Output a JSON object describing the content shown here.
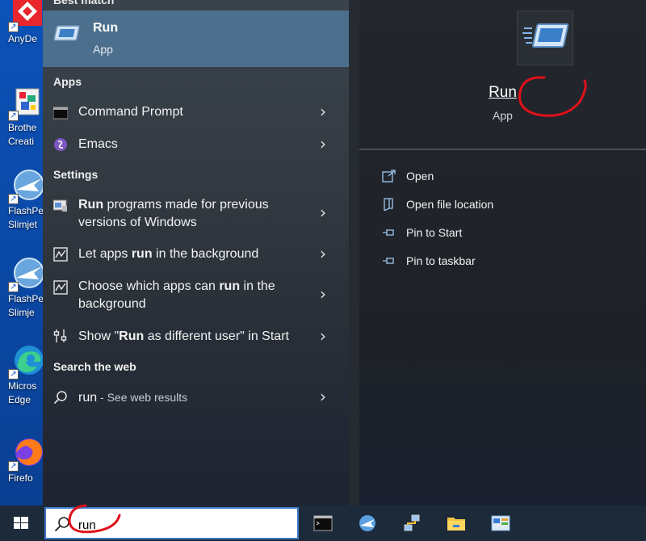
{
  "desktop": {
    "icons": [
      {
        "label": "AnyDe",
        "icon": "anydesk-icon"
      },
      {
        "label": "Brothe Creati",
        "icon": "brother-creative-icon"
      },
      {
        "label": "FlashPe Slimjet",
        "icon": "slimjet-icon"
      },
      {
        "label": "FlashPe Slimje",
        "icon": "slimjet-icon"
      },
      {
        "label": "Micros Edge",
        "icon": "edge-icon"
      },
      {
        "label": "Firefo",
        "icon": "firefox-icon"
      }
    ]
  },
  "search_panel": {
    "best_match_header": "Best match",
    "best_match": {
      "title": "Run",
      "subtitle": "App",
      "icon": "run-app-icon"
    },
    "sections": {
      "apps": "Apps",
      "settings": "Settings",
      "web": "Search the web"
    },
    "apps": [
      {
        "label": "Command Prompt",
        "icon": "command-prompt-icon"
      },
      {
        "label": "Emacs",
        "icon": "emacs-icon"
      }
    ],
    "settings": [
      {
        "bold": "Run",
        "rest": " programs made for previous versions of Windows",
        "icon": "compatibility-icon"
      },
      {
        "pre": "Let apps ",
        "bold": "run",
        "rest": " in the background",
        "icon": "background-apps-icon"
      },
      {
        "pre": "Choose which apps can ",
        "bold": "run",
        "rest": " in the background",
        "icon": "background-apps-icon"
      },
      {
        "pre": "Show \"",
        "bold": "Run",
        "rest": " as different user\" in Start",
        "icon": "settings-sliders-icon"
      }
    ],
    "web": {
      "query": "run",
      "suffix": " - See web results",
      "icon": "search-icon"
    },
    "chevron": "›"
  },
  "details": {
    "app_name": "Run",
    "app_type": "App",
    "actions": [
      {
        "label": "Open",
        "icon": "open-icon"
      },
      {
        "label": "Open file location",
        "icon": "file-location-icon"
      },
      {
        "label": "Pin to Start",
        "icon": "pin-icon"
      },
      {
        "label": "Pin to taskbar",
        "icon": "pin-icon"
      }
    ]
  },
  "taskbar": {
    "search_value": "run",
    "apps": [
      "command-prompt-icon",
      "globe-browser-icon",
      "network-icon",
      "file-explorer-icon",
      "control-panel-icon"
    ]
  },
  "colors": {
    "accent_selected": "#4b6f8c",
    "annotation_red": "#e0101a",
    "desktop_blue": "#0b4aa8"
  }
}
